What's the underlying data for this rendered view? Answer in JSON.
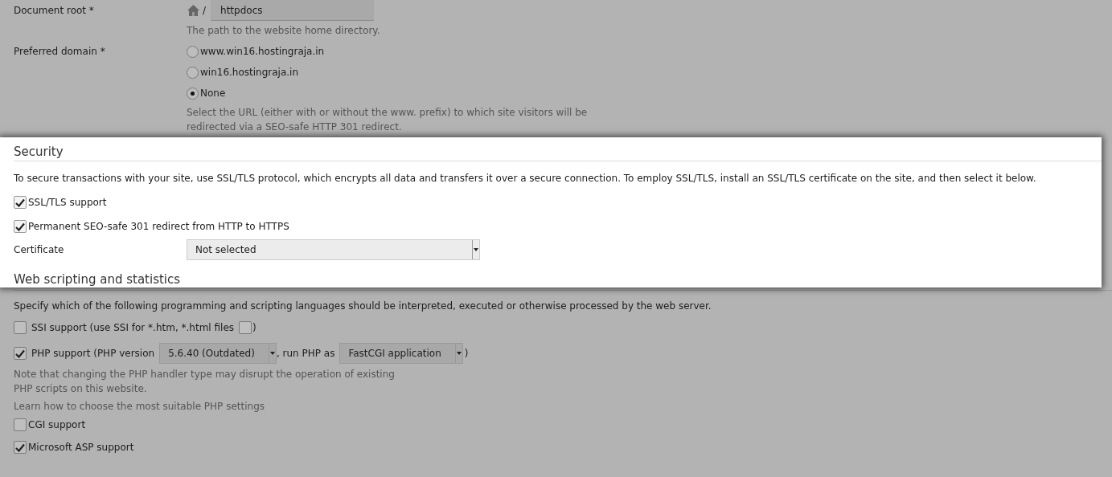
{
  "document_root": {
    "label": "Document root *",
    "separator": "/",
    "value": "httpdocs",
    "hint": "The path to the website home directory."
  },
  "preferred_domain": {
    "label": "Preferred domain *",
    "options": [
      {
        "label": "www.win16.hostingraja.in",
        "selected": false
      },
      {
        "label": "win16.hostingraja.in",
        "selected": false
      },
      {
        "label": "None",
        "selected": true
      }
    ],
    "hint": "Select the URL (either with or without the www. prefix) to which site visitors will be redirected via a SEO-safe HTTP 301 redirect."
  },
  "security": {
    "title": "Security",
    "description": "To secure transactions with your site, use SSL/TLS protocol, which encrypts all data and transfers it over a secure connection. To employ SSL/TLS, install an SSL/TLS certificate on the site, and then select it below.",
    "options": [
      {
        "label": "SSL/TLS support",
        "checked": true
      },
      {
        "label": "Permanent SEO-safe 301 redirect from HTTP to HTTPS",
        "checked": true
      }
    ],
    "certificate": {
      "label": "Certificate",
      "value": "Not selected"
    }
  },
  "web_scripting": {
    "title": "Web scripting and statistics",
    "description": "Specify which of the following programming and scripting languages should be interpreted, executed or otherwise processed by the web server.",
    "ssi": {
      "label": "SSI support (use SSI for *.htm, *.html files",
      "checked": false,
      "sub_checked": false,
      "close": ")"
    },
    "php": {
      "label": "PHP support (PHP version",
      "checked": true,
      "version": "5.6.40 (Outdated)",
      "run_as_label": ", run PHP as",
      "handler": "FastCGI application",
      "close": ")",
      "note": "Note that changing the PHP handler type may disrupt the operation of existing PHP scripts on this website.",
      "link": "Learn how to choose the most suitable PHP settings"
    },
    "options": [
      {
        "label": "CGI support",
        "checked": false
      },
      {
        "label": "Microsoft ASP support",
        "checked": true
      }
    ]
  }
}
